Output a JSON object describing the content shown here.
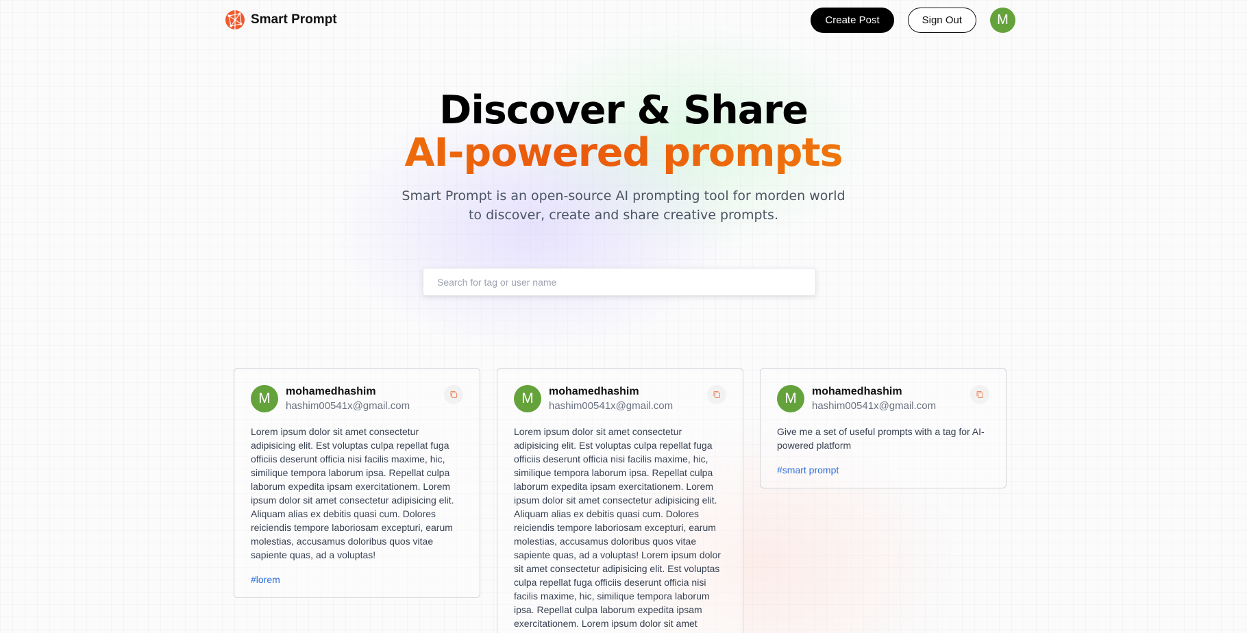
{
  "brand": {
    "name": "Smart Prompt"
  },
  "nav": {
    "create_label": "Create Post",
    "signout_label": "Sign Out",
    "avatar_initial": "M"
  },
  "hero": {
    "line1": "Discover & Share",
    "line2": "AI-powered prompts",
    "subtitle": "Smart Prompt is an open-source AI prompting tool for morden world to discover, create and share creative prompts."
  },
  "search": {
    "placeholder": "Search for tag or user name",
    "value": ""
  },
  "colors": {
    "accent_start": "#f59e0b",
    "accent_mid": "#ea580c",
    "avatar": "#64a23b",
    "tag": "#2f6fdb",
    "copy_icon": "#ef8a63"
  },
  "posts": [
    {
      "initial": "M",
      "username": "mohamedhashim",
      "email": "hashim00541x@gmail.com",
      "prompt": "Lorem ipsum dolor sit amet consectetur adipisicing elit. Est voluptas culpa repellat fuga officiis deserunt officia nisi facilis maxime, hic, similique tempora laborum ipsa. Repellat culpa laborum expedita ipsam exercitationem. Lorem ipsum dolor sit amet consectetur adipisicing elit. Aliquam alias ex debitis quasi cum. Dolores reiciendis tempore laboriosam excepturi, earum molestias, accusamus doloribus quos vitae sapiente quas, ad a voluptas!",
      "tag": "#lorem",
      "copy_icon": "copy-icon"
    },
    {
      "initial": "M",
      "username": "mohamedhashim",
      "email": "hashim00541x@gmail.com",
      "prompt": "Lorem ipsum dolor sit amet consectetur adipisicing elit. Est voluptas culpa repellat fuga officiis deserunt officia nisi facilis maxime, hic, similique tempora laborum ipsa. Repellat culpa laborum expedita ipsam exercitationem. Lorem ipsum dolor sit amet consectetur adipisicing elit. Aliquam alias ex debitis quasi cum. Dolores reiciendis tempore laboriosam excepturi, earum molestias, accusamus doloribus quos vitae sapiente quas, ad a voluptas! Lorem ipsum dolor sit amet consectetur adipisicing elit. Est voluptas culpa repellat fuga officiis deserunt officia nisi facilis maxime, hic, similique tempora laborum ipsa. Repellat culpa laborum expedita ipsam exercitationem. Lorem ipsum dolor sit amet",
      "tag": "",
      "copy_icon": "copy-icon"
    },
    {
      "initial": "M",
      "username": "mohamedhashim",
      "email": "hashim00541x@gmail.com",
      "prompt": "Give me a set of useful prompts with a tag for AI-powered platform",
      "tag": "#smart prompt",
      "copy_icon": "copy-icon"
    }
  ]
}
